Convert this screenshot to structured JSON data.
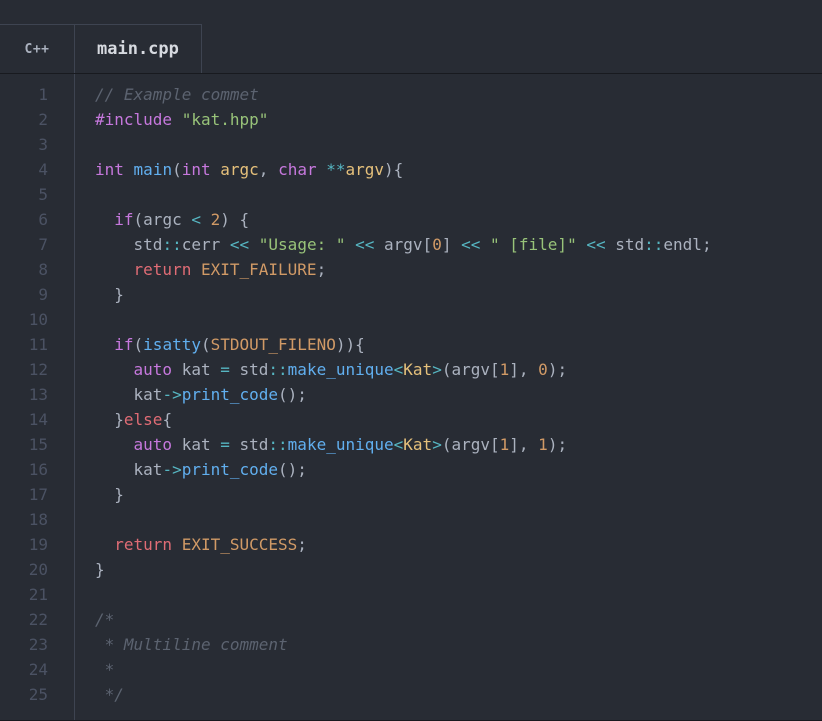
{
  "header": {
    "lang_badge": "C++",
    "filename": "main.cpp"
  },
  "gutter": {
    "start": 1,
    "end": 25
  },
  "code": {
    "lines": [
      [
        {
          "c": "comment",
          "t": "// Example commet"
        }
      ],
      [
        {
          "c": "preproc",
          "t": "#include"
        },
        {
          "c": "default",
          "t": " "
        },
        {
          "c": "string",
          "t": "\"kat.hpp\""
        }
      ],
      [],
      [
        {
          "c": "type",
          "t": "int"
        },
        {
          "c": "default",
          "t": " "
        },
        {
          "c": "func",
          "t": "main"
        },
        {
          "c": "punct",
          "t": "("
        },
        {
          "c": "type",
          "t": "int"
        },
        {
          "c": "default",
          "t": " "
        },
        {
          "c": "param",
          "t": "argc"
        },
        {
          "c": "punct",
          "t": ", "
        },
        {
          "c": "type",
          "t": "char"
        },
        {
          "c": "default",
          "t": " "
        },
        {
          "c": "operator",
          "t": "**"
        },
        {
          "c": "param",
          "t": "argv"
        },
        {
          "c": "punct",
          "t": "){"
        }
      ],
      [],
      [
        {
          "c": "default",
          "t": "  "
        },
        {
          "c": "keyword",
          "t": "if"
        },
        {
          "c": "punct",
          "t": "("
        },
        {
          "c": "var",
          "t": "argc"
        },
        {
          "c": "default",
          "t": " "
        },
        {
          "c": "operator",
          "t": "<"
        },
        {
          "c": "default",
          "t": " "
        },
        {
          "c": "number",
          "t": "2"
        },
        {
          "c": "punct",
          "t": ") {"
        }
      ],
      [
        {
          "c": "default",
          "t": "    std"
        },
        {
          "c": "operator",
          "t": "::"
        },
        {
          "c": "var",
          "t": "cerr"
        },
        {
          "c": "default",
          "t": " "
        },
        {
          "c": "operator",
          "t": "<<"
        },
        {
          "c": "default",
          "t": " "
        },
        {
          "c": "string",
          "t": "\"Usage: \""
        },
        {
          "c": "default",
          "t": " "
        },
        {
          "c": "operator",
          "t": "<<"
        },
        {
          "c": "default",
          "t": " argv["
        },
        {
          "c": "number",
          "t": "0"
        },
        {
          "c": "default",
          "t": "] "
        },
        {
          "c": "operator",
          "t": "<<"
        },
        {
          "c": "default",
          "t": " "
        },
        {
          "c": "string",
          "t": "\" [file]\""
        },
        {
          "c": "default",
          "t": " "
        },
        {
          "c": "operator",
          "t": "<<"
        },
        {
          "c": "default",
          "t": " std"
        },
        {
          "c": "operator",
          "t": "::"
        },
        {
          "c": "var",
          "t": "endl"
        },
        {
          "c": "punct",
          "t": ";"
        }
      ],
      [
        {
          "c": "default",
          "t": "    "
        },
        {
          "c": "keyword2",
          "t": "return"
        },
        {
          "c": "default",
          "t": " "
        },
        {
          "c": "constant",
          "t": "EXIT_FAILURE"
        },
        {
          "c": "punct",
          "t": ";"
        }
      ],
      [
        {
          "c": "default",
          "t": "  "
        },
        {
          "c": "punct",
          "t": "}"
        }
      ],
      [],
      [
        {
          "c": "default",
          "t": "  "
        },
        {
          "c": "keyword",
          "t": "if"
        },
        {
          "c": "punct",
          "t": "("
        },
        {
          "c": "func",
          "t": "isatty"
        },
        {
          "c": "punct",
          "t": "("
        },
        {
          "c": "constant",
          "t": "STDOUT_FILENO"
        },
        {
          "c": "punct",
          "t": ")){"
        }
      ],
      [
        {
          "c": "default",
          "t": "    "
        },
        {
          "c": "type",
          "t": "auto"
        },
        {
          "c": "default",
          "t": " kat "
        },
        {
          "c": "operator",
          "t": "="
        },
        {
          "c": "default",
          "t": " std"
        },
        {
          "c": "operator",
          "t": "::"
        },
        {
          "c": "func",
          "t": "make_unique"
        },
        {
          "c": "operator",
          "t": "<"
        },
        {
          "c": "class",
          "t": "Kat"
        },
        {
          "c": "operator",
          "t": ">"
        },
        {
          "c": "punct",
          "t": "(argv["
        },
        {
          "c": "number",
          "t": "1"
        },
        {
          "c": "punct",
          "t": "], "
        },
        {
          "c": "number",
          "t": "0"
        },
        {
          "c": "punct",
          "t": ");"
        }
      ],
      [
        {
          "c": "default",
          "t": "    kat"
        },
        {
          "c": "operator",
          "t": "->"
        },
        {
          "c": "func",
          "t": "print_code"
        },
        {
          "c": "punct",
          "t": "();"
        }
      ],
      [
        {
          "c": "default",
          "t": "  "
        },
        {
          "c": "punct",
          "t": "}"
        },
        {
          "c": "keyword2",
          "t": "else"
        },
        {
          "c": "punct",
          "t": "{"
        }
      ],
      [
        {
          "c": "default",
          "t": "    "
        },
        {
          "c": "type",
          "t": "auto"
        },
        {
          "c": "default",
          "t": " kat "
        },
        {
          "c": "operator",
          "t": "="
        },
        {
          "c": "default",
          "t": " std"
        },
        {
          "c": "operator",
          "t": "::"
        },
        {
          "c": "func",
          "t": "make_unique"
        },
        {
          "c": "operator",
          "t": "<"
        },
        {
          "c": "class",
          "t": "Kat"
        },
        {
          "c": "operator",
          "t": ">"
        },
        {
          "c": "punct",
          "t": "(argv["
        },
        {
          "c": "number",
          "t": "1"
        },
        {
          "c": "punct",
          "t": "], "
        },
        {
          "c": "number",
          "t": "1"
        },
        {
          "c": "punct",
          "t": ");"
        }
      ],
      [
        {
          "c": "default",
          "t": "    kat"
        },
        {
          "c": "operator",
          "t": "->"
        },
        {
          "c": "func",
          "t": "print_code"
        },
        {
          "c": "punct",
          "t": "();"
        }
      ],
      [
        {
          "c": "default",
          "t": "  "
        },
        {
          "c": "punct",
          "t": "}"
        }
      ],
      [],
      [
        {
          "c": "default",
          "t": "  "
        },
        {
          "c": "keyword2",
          "t": "return"
        },
        {
          "c": "default",
          "t": " "
        },
        {
          "c": "constant",
          "t": "EXIT_SUCCESS"
        },
        {
          "c": "punct",
          "t": ";"
        }
      ],
      [
        {
          "c": "punct",
          "t": "}"
        }
      ],
      [],
      [
        {
          "c": "comment",
          "t": "/*"
        }
      ],
      [
        {
          "c": "comment",
          "t": " * Multiline comment"
        }
      ],
      [
        {
          "c": "comment",
          "t": " *"
        }
      ],
      [
        {
          "c": "comment",
          "t": " */"
        }
      ]
    ]
  }
}
